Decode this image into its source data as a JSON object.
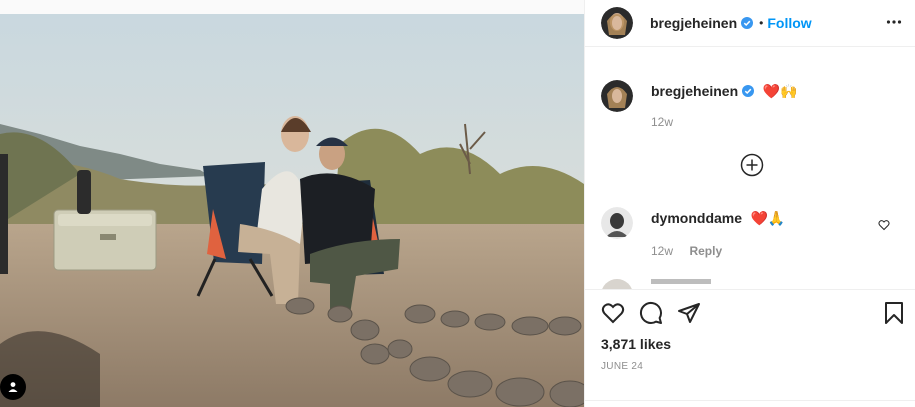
{
  "post": {
    "username": "bregjeheinen",
    "follow_label": "Follow",
    "separator": "•",
    "caption_emojis": "❤️🙌",
    "caption_time": "12w",
    "likes": "3,871 likes",
    "date": "JUNE 24"
  },
  "comments": [
    {
      "username": "dymonddame",
      "emojis": "❤️🙏",
      "time": "12w",
      "reply_label": "Reply"
    }
  ],
  "colors": {
    "accent": "#0095f6",
    "heart": "#ed4956",
    "text": "#262626",
    "muted": "#8e8e8e"
  },
  "icons": [
    "verified-icon",
    "more-icon",
    "add-circle-icon",
    "heart-outline-icon",
    "comment-icon",
    "share-icon",
    "bookmark-icon",
    "user-tag-icon"
  ]
}
